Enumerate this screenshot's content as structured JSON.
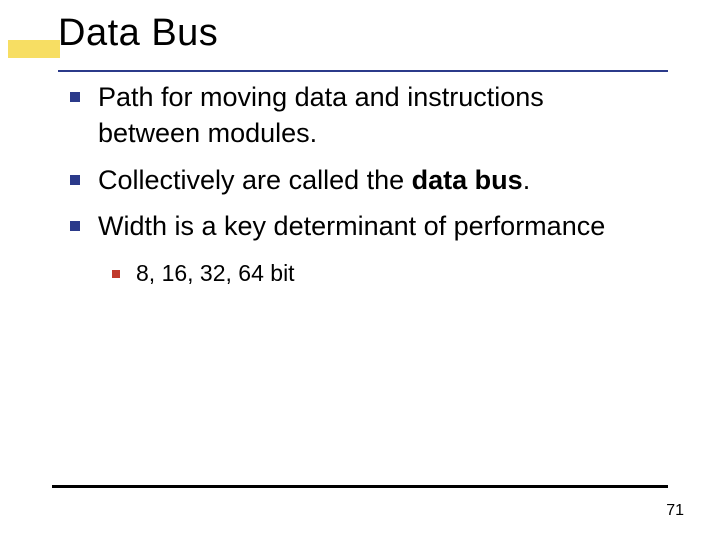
{
  "slide": {
    "title": "Data Bus",
    "bullets": [
      {
        "text": "Path for moving data and instructions between modules."
      },
      {
        "pre": "Collectively are called the ",
        "bold": "data bus",
        "post": "."
      },
      {
        "text": "Width is a key determinant of performance",
        "sub": [
          "8, 16, 32, 64 bit"
        ]
      }
    ],
    "page_number": "71"
  }
}
